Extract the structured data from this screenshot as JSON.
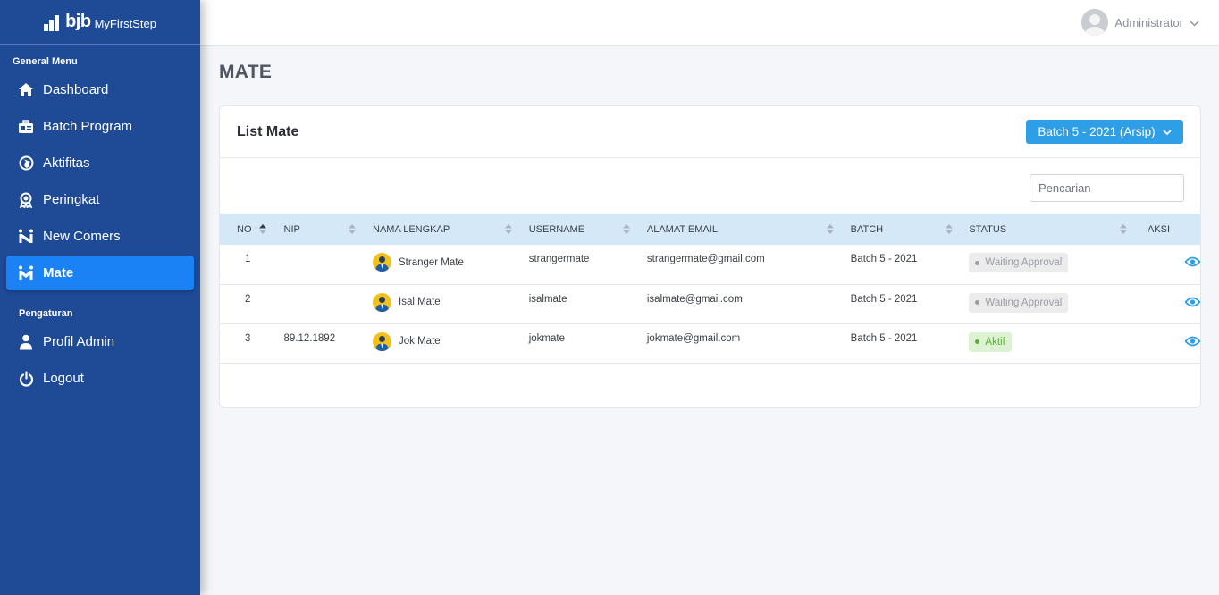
{
  "brand": {
    "logo_text": "bjb",
    "app_name": "MyFirstStep"
  },
  "sidebar": {
    "section_general": "General Menu",
    "items": [
      {
        "label": "Dashboard",
        "icon": "home-icon"
      },
      {
        "label": "Batch Program",
        "icon": "briefcase-icon"
      },
      {
        "label": "Aktifitas",
        "icon": "globe-icon"
      },
      {
        "label": "Peringkat",
        "icon": "award-icon"
      },
      {
        "label": "New Comers",
        "icon": "new-comers-icon"
      },
      {
        "label": "Mate",
        "icon": "mate-icon",
        "active": true
      }
    ],
    "section_settings": "Pengaturan",
    "settings_items": [
      {
        "label": "Profil Admin",
        "icon": "user-icon"
      },
      {
        "label": "Logout",
        "icon": "power-icon"
      }
    ]
  },
  "header": {
    "user_name": "Administrator"
  },
  "page": {
    "title": "MATE"
  },
  "card": {
    "title": "List Mate",
    "batch_selected": "Batch 5 - 2021 (Arsip)",
    "search_placeholder": "Pencarian"
  },
  "table": {
    "columns": [
      "NO",
      "NIP",
      "NAMA LENGKAP",
      "USERNAME",
      "ALAMAT EMAIL",
      "BATCH",
      "STATUS",
      "AKSI"
    ],
    "rows": [
      {
        "no": "1",
        "nip": "",
        "name": "Stranger Mate",
        "username": "strangermate",
        "email": "strangermate@gmail.com",
        "batch": "Batch 5 - 2021",
        "status": "Waiting Approval"
      },
      {
        "no": "2",
        "nip": "",
        "name": "Isal Mate",
        "username": "isalmate",
        "email": "isalmate@gmail.com",
        "batch": "Batch 5 - 2021",
        "status": "Waiting Approval"
      },
      {
        "no": "3",
        "nip": "89.12.1892",
        "name": "Jok Mate",
        "username": "jokmate",
        "email": "jokmate@gmail.com",
        "batch": "Batch 5 - 2021",
        "status": "Aktif"
      }
    ]
  },
  "colors": {
    "sidebar_bg": "#1e4a96",
    "active_item": "#1a82f5",
    "batch_button": "#2e9ee6",
    "table_header": "#d5e8f7",
    "status_waiting": "#9a9ea5",
    "status_active": "#58b12a",
    "eye_icon": "#2e9ee6"
  }
}
